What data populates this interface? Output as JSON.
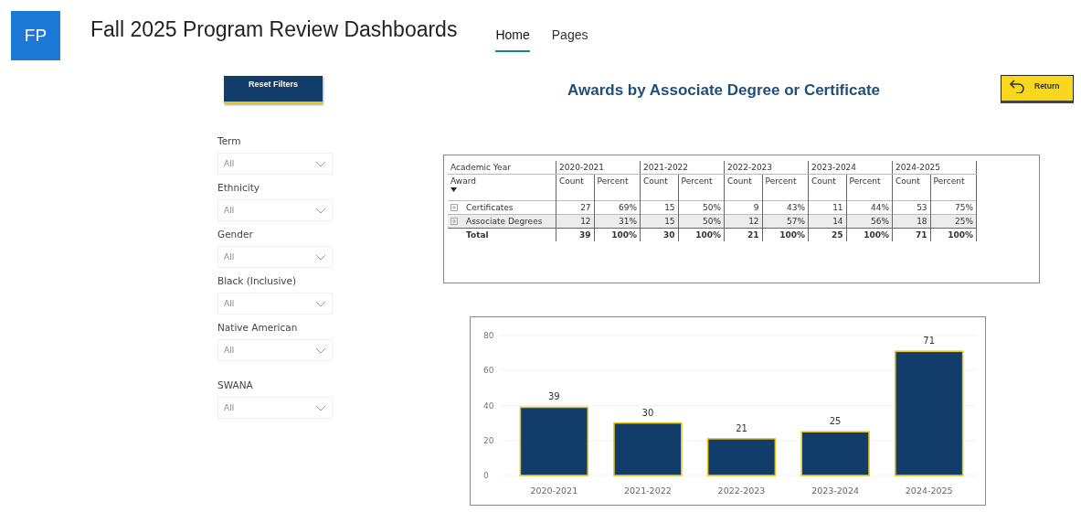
{
  "header": {
    "logo": "FP",
    "title": "Fall 2025 Program Review Dashboards",
    "nav": [
      {
        "label": "Home",
        "selected": true
      },
      {
        "label": "Pages",
        "selected": false
      }
    ]
  },
  "reset_button": "Reset Filters",
  "return_button": "Return",
  "page_title": "Awards by Associate Degree or Certificate",
  "filters": [
    {
      "label": "Term",
      "value": "All"
    },
    {
      "label": "Ethnicity",
      "value": "All"
    },
    {
      "label": "Gender",
      "value": "All"
    },
    {
      "label": "Black (Inclusive)",
      "value": "All"
    },
    {
      "label": "Native American",
      "value": "All"
    },
    {
      "label": "SWANA",
      "value": "All"
    }
  ],
  "table": {
    "corner_top": "Academic Year",
    "corner_bottom": "Award",
    "years": [
      {
        "label": "2020-2021",
        "subheaders": [
          "Count",
          "Percent"
        ]
      },
      {
        "label": "2021-2022",
        "subheaders": [
          "Count",
          "Percent"
        ]
      },
      {
        "label": "2022-2023",
        "subheaders": [
          "Count",
          "Percent"
        ]
      },
      {
        "label": "2023-2024",
        "subheaders": [
          "Count",
          "Percent"
        ]
      },
      {
        "label": "2024-2025",
        "subheaders": [
          "Count",
          "Percent"
        ]
      }
    ],
    "rows": [
      {
        "kind": "group",
        "label": "Certificates",
        "shaded": false,
        "values": [
          "27",
          "69%",
          "15",
          "50%",
          "9",
          "43%",
          "11",
          "44%",
          "53",
          "75%"
        ]
      },
      {
        "kind": "group",
        "label": "Associate Degrees",
        "shaded": true,
        "values": [
          "12",
          "31%",
          "15",
          "50%",
          "12",
          "57%",
          "14",
          "56%",
          "18",
          "25%"
        ]
      },
      {
        "kind": "total",
        "label": "Total",
        "shaded": false,
        "values": [
          "39",
          "100%",
          "30",
          "100%",
          "21",
          "100%",
          "25",
          "100%",
          "71",
          "100%"
        ]
      }
    ]
  },
  "chart": {
    "chart_data": {
      "type": "bar",
      "categories": [
        "2020-2021",
        "2021-2022",
        "2022-2023",
        "2023-2024",
        "2024-2025"
      ],
      "series": [
        {
          "color": "#123c69",
          "values": [
            39,
            30,
            21,
            25,
            71
          ]
        }
      ],
      "ylim": [
        0,
        80
      ],
      "yticks": [
        0,
        20,
        40,
        60,
        80
      ],
      "grid": true,
      "value_labels": [
        "39",
        "30",
        "21",
        "25",
        "71"
      ]
    }
  }
}
